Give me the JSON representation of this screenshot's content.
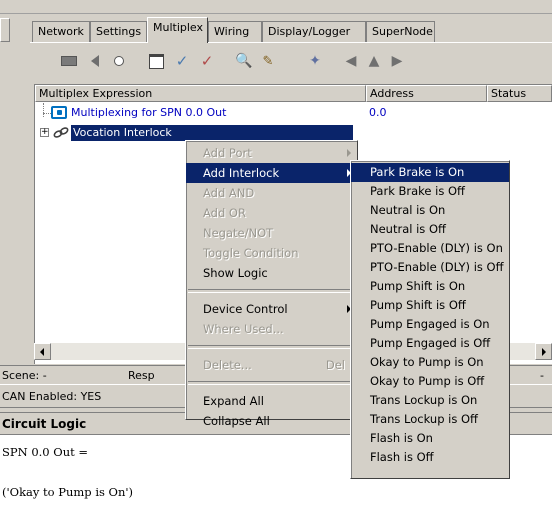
{
  "tabs": [
    "Network",
    "Settings",
    "Multiplex",
    "Wiring",
    "Display/Logger",
    "SuperNode"
  ],
  "toolbar_icons": [
    "record-icon",
    "back-icon",
    "circle-icon",
    "window-icon",
    "check-blue-icon",
    "check-red-icon",
    "zoom-icon",
    "edit-icon",
    "clear-icon",
    "arrow-left-icon",
    "arrow-up-icon",
    "arrow-right-icon"
  ],
  "list": {
    "columns": [
      "Multiplex Expression",
      "Address",
      "Status"
    ],
    "rows": [
      {
        "label": "Multiplexing for SPN 0.0 Out",
        "address": "0.0"
      },
      {
        "label": "Vocation Interlock",
        "address": ""
      }
    ]
  },
  "status": {
    "scene": "Scene: -",
    "resp": "Resp",
    "can": "CAN Enabled: YES",
    "right_dash": "-"
  },
  "logic": {
    "title": "Circuit Logic",
    "line1": "SPN 0.0 Out =",
    "line2": "('Okay to Pump is On')"
  },
  "context_menu": {
    "items": [
      {
        "label": "Add Port",
        "disabled": true,
        "arrow": true
      },
      {
        "label": "Add Interlock",
        "selected": true,
        "arrow": true
      },
      {
        "label": "Add AND",
        "disabled": true
      },
      {
        "label": "Add OR",
        "disabled": true
      },
      {
        "label": "Negate/NOT",
        "disabled": true
      },
      {
        "label": "Toggle Condition",
        "disabled": true
      },
      {
        "label": "Show Logic"
      },
      {
        "sep": true
      },
      {
        "label": "Device Control",
        "arrow": true
      },
      {
        "label": "Where Used...",
        "disabled": true
      },
      {
        "sep": true
      },
      {
        "label": "Delete...",
        "disabled": true,
        "shortcut": "Del"
      },
      {
        "sep": true
      },
      {
        "label": "Expand All"
      },
      {
        "label": "Collapse All"
      }
    ]
  },
  "submenu": {
    "items": [
      "Park Brake is On",
      "Park Brake is Off",
      "Neutral is On",
      "Neutral is Off",
      "PTO-Enable (DLY) is On",
      "PTO-Enable (DLY) is Off",
      "Pump Shift is On",
      "Pump Shift is Off",
      "Pump Engaged is On",
      "Pump Engaged is Off",
      "Okay to Pump is On",
      "Okay to Pump is Off",
      "Trans Lockup is On",
      "Trans Lockup is Off",
      "Flash is On",
      "Flash is Off"
    ],
    "selected_index": 0
  },
  "colors": {
    "selection": "#0a246a",
    "face": "#d4d0c8",
    "link_blue": "#0000c0"
  }
}
